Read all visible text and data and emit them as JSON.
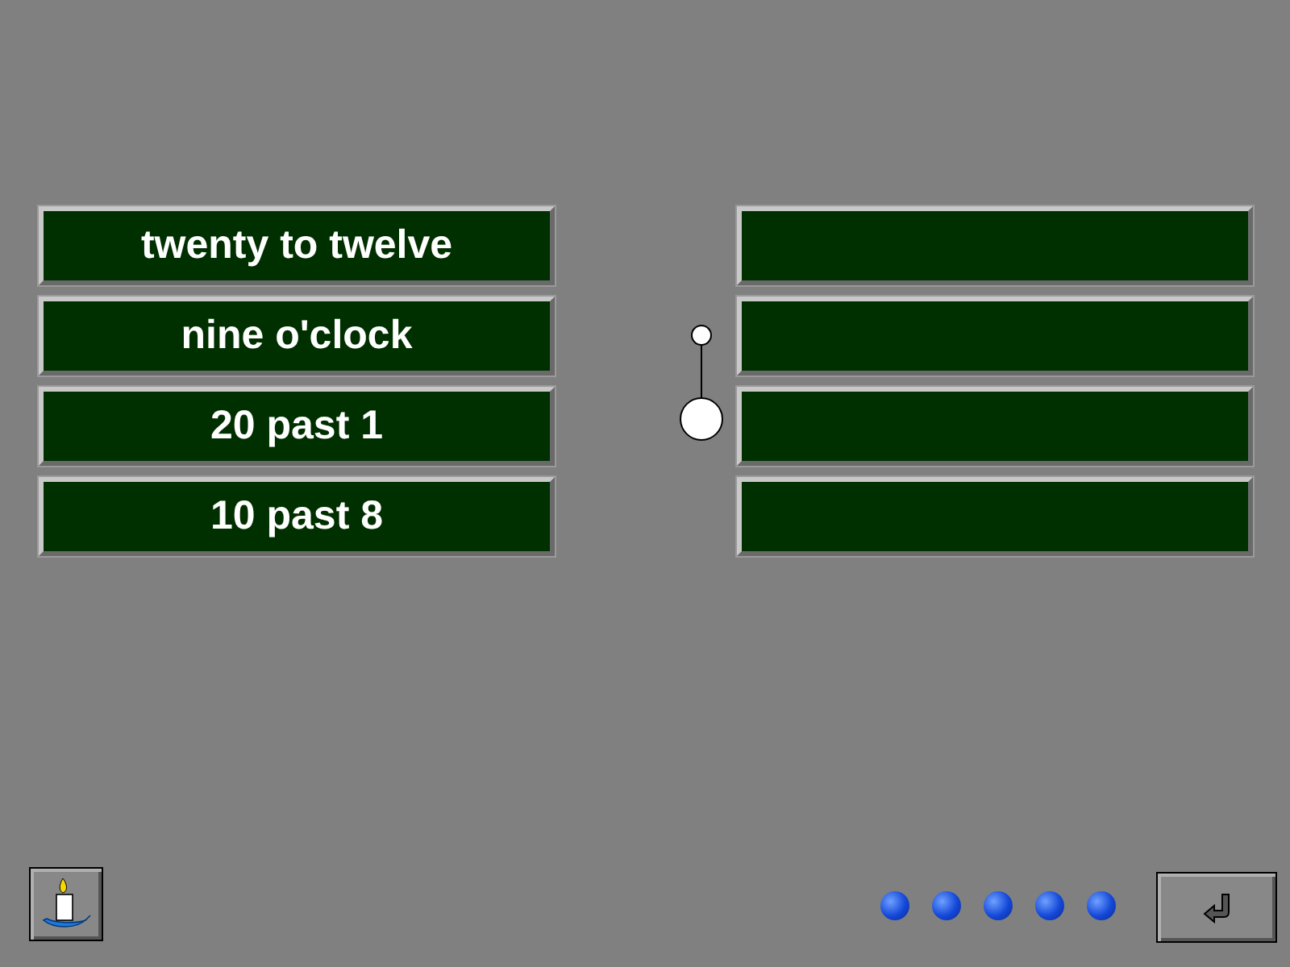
{
  "phrases": [
    {
      "label": "twenty to twelve"
    },
    {
      "label": "nine o'clock"
    },
    {
      "label": "20 past 1"
    },
    {
      "label": "10 past 8"
    }
  ],
  "answer_slots": [
    {
      "kind": "empty"
    },
    {
      "kind": "empty"
    },
    {
      "kind": "empty"
    },
    {
      "kind": "empty"
    }
  ],
  "progress_dots": [
    {
      "kind": "pending"
    },
    {
      "kind": "pending"
    },
    {
      "kind": "pending"
    },
    {
      "kind": "pending"
    },
    {
      "kind": "pending"
    }
  ]
}
